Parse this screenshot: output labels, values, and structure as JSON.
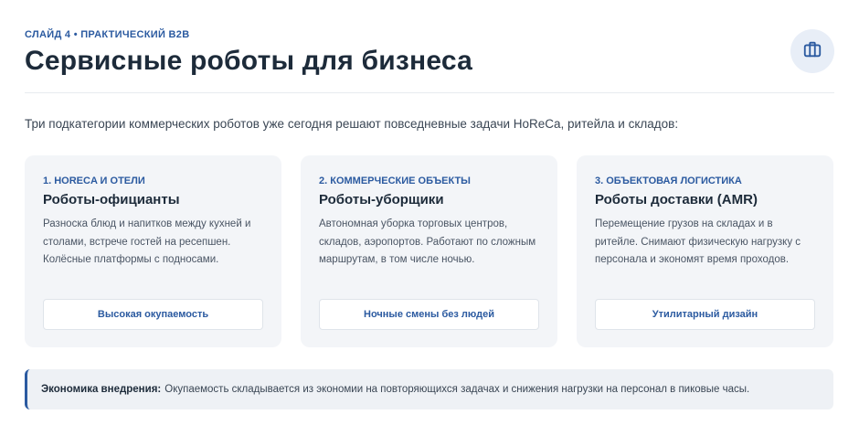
{
  "header": {
    "kicker": "СЛАЙД 4 • ПРАКТИЧЕСКИЙ B2B",
    "title": "Сервисные роботы для бизнеса",
    "icon": "briefcase-icon"
  },
  "intro": "Три подкатегории коммерческих роботов уже сегодня решают повседневные задачи HoReCa, ритейла и складов:",
  "cards": [
    {
      "category": "1. HORECA И ОТЕЛИ",
      "title": "Роботы-официанты",
      "description": "Разноска блюд и напитков между кухней и столами, встрече гостей на ресепшен. Колёсные платформы с подносами.",
      "tag": "Высокая окупаемость"
    },
    {
      "category": "2. КОММЕРЧЕСКИЕ ОБЪЕКТЫ",
      "title": "Роботы-уборщики",
      "description": "Автономная уборка торговых центров, складов, аэропортов. Работают по сложным маршрутам, в том числе ночью.",
      "tag": "Ночные смены без людей"
    },
    {
      "category": "3. ОБЪЕКТОВАЯ ЛОГИСТИКА",
      "title": "Роботы доставки (AMR)",
      "description": "Перемещение грузов на складах и в ритейле. Снимают физическую нагрузку с персонала и экономят время проходов.",
      "tag": "Утилитарный дизайн"
    }
  ],
  "note": {
    "label": "Экономика внедрения:",
    "text": "Окупаемость складывается из экономии на повторяющихся задачах и снижения нагрузки на персонал в пиковые часы."
  },
  "colors": {
    "accent": "#2b5aa0",
    "card_bg": "#f3f5f8",
    "note_bg": "#eef1f5"
  }
}
